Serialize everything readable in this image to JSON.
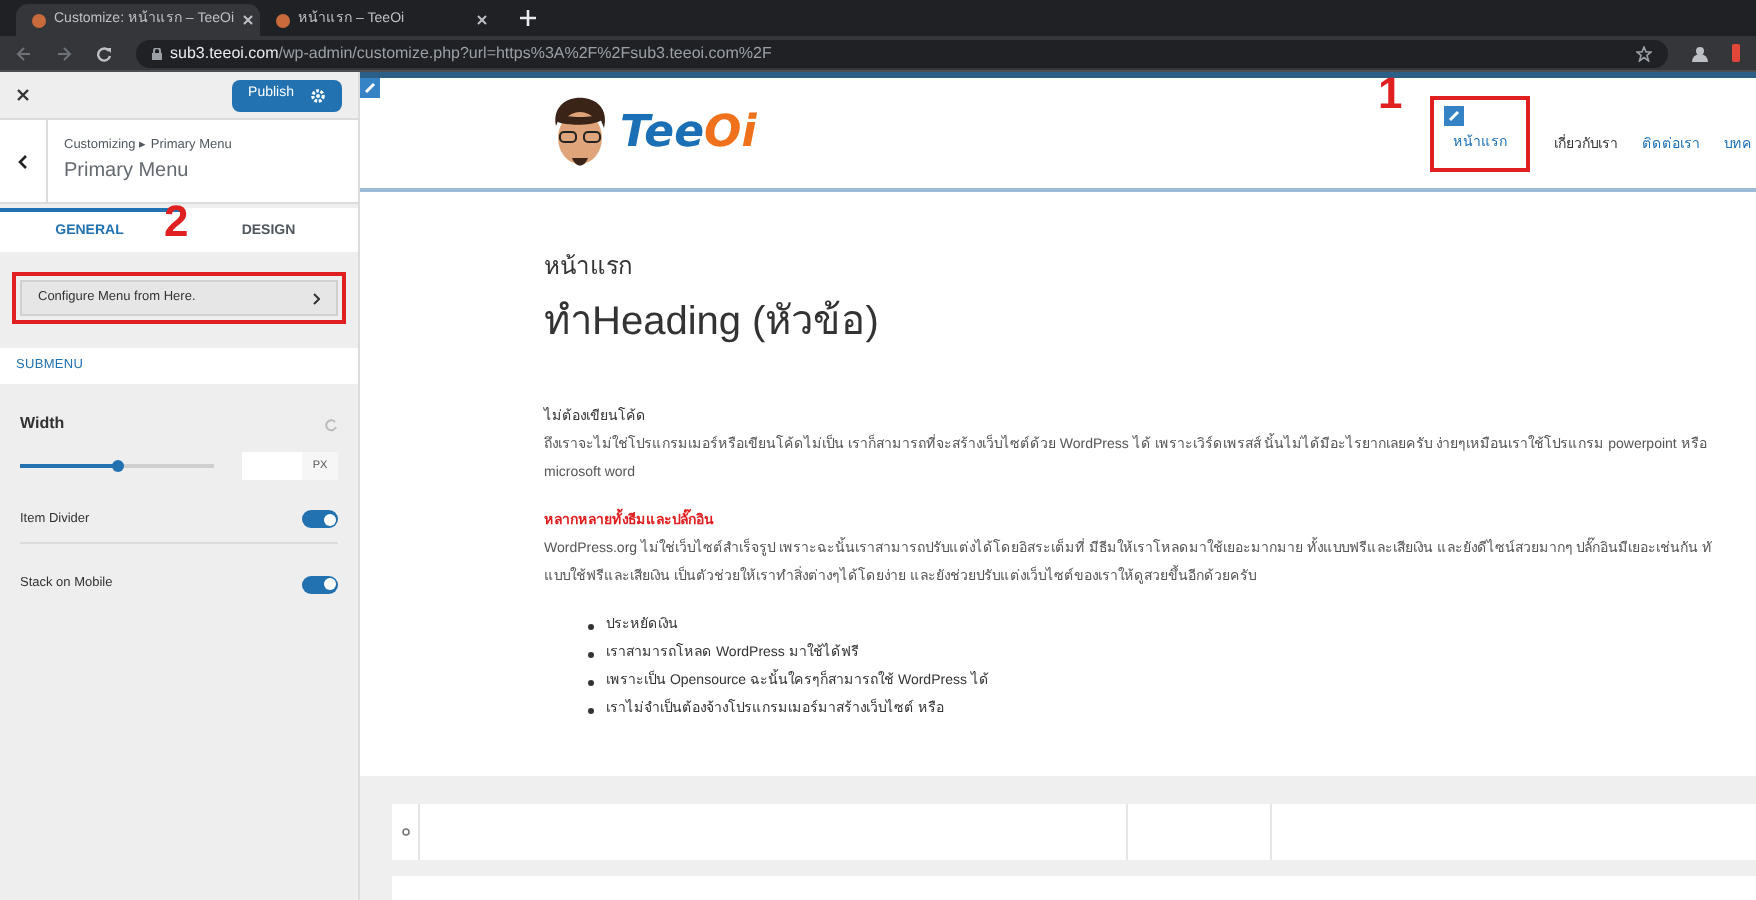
{
  "browser": {
    "tabs": [
      {
        "title": "Customize: หน้าแรก – TeeOi",
        "selected": true
      },
      {
        "title": "หน้าแรก – TeeOi",
        "selected": false
      }
    ],
    "url": {
      "host": "sub3.teeoi.com",
      "path": "/wp-admin/customize.php?url=https%3A%2F%2Fsub3.teeoi.com%2F"
    }
  },
  "sidebar": {
    "publish": "Publish",
    "breadcrumb": "Customizing ▸ Primary Menu",
    "title": "Primary Menu",
    "tabs": [
      {
        "label": "GENERAL",
        "selected": true
      },
      {
        "label": "DESIGN",
        "selected": false
      }
    ],
    "configure_button": "Configure Menu from Here.",
    "section": "SUBMENU",
    "width": {
      "label": "Width",
      "level": 0.51,
      "unit": "PX"
    },
    "toggles": [
      {
        "label": "Item Divider",
        "on": true
      },
      {
        "label": "Stack on Mobile",
        "on": true
      }
    ]
  },
  "preview": {
    "logo": [
      {
        "text": "Tee",
        "color": "#1b6fb5"
      },
      {
        "text": "Oi",
        "color": "#f0711c"
      }
    ],
    "nav": [
      {
        "label": "หน้าแรก",
        "selected": true
      },
      {
        "label": "เกี่ยวกับเรา",
        "selected": false
      },
      {
        "label": "ติดต่อเรา",
        "selected": false
      },
      {
        "label": "บทค",
        "selected": false
      }
    ],
    "page_title": "หน้าแรก",
    "heading": "ทำHeading (หัวข้อ)",
    "blocks": [
      {
        "kind": "subhead",
        "text": "ไม่ต้องเขียนโค้ด"
      },
      {
        "kind": "line",
        "text": "ถึงเราจะไม่ใช่โปรแกรมเมอร์หรือเขียนโค้ดไม่เป็น เราก็สามารถที่จะสร้างเว็บไซต์ด้วย WordPress ได้ เพราะเวิร์ดเพรสส์ นั้นไม่ได้มีอะไรยากเลยครับ ง่ายๆเหมือนเราใช้โปรแกรม powerpoint หรือ"
      },
      {
        "kind": "line",
        "text": "microsoft word"
      },
      {
        "kind": "red",
        "text": "หลากหลายทั้งธีมและปลั๊กอิน"
      },
      {
        "kind": "line",
        "text": "WordPress.org ไม่ใช่เว็บไซต์สำเร็จรูป เพราะฉะนั้นเราสามารถปรับแต่งได้โดยอิสระเต็มที่ มีธีมให้เราโหลดมาใช้เยอะมากมาย ทั้งแบบฟรีและเสียเงิน และยังดีไซน์สวยมากๆ ปลั๊กอินมีเยอะเช่นกัน ทั"
      },
      {
        "kind": "line",
        "text": "แบบใช้ฟรีและเสียเงิน เป็นตัวช่วยให้เราทำสิ่งต่างๆได้โดยง่าย และยังช่วยปรับแต่งเว็บไซต์ของเราให้ดูสวยขึ้นอีกด้วยครับ"
      }
    ],
    "bullets": [
      "ประหยัดเงิน",
      "เราสามารถโหลด WordPress มาใช้ได้ฟรี",
      "เพราะเป็น Opensource ฉะนั้นใครๆก็สามารถใช้ WordPress ได้",
      "เราไม่จำเป็นต้องจ้างโปรแกรมเมอร์มาสร้างเว็บไซต์ หรือ"
    ]
  },
  "annotations": [
    {
      "kind": "number",
      "text": "1"
    },
    {
      "kind": "number",
      "text": "2"
    }
  ]
}
